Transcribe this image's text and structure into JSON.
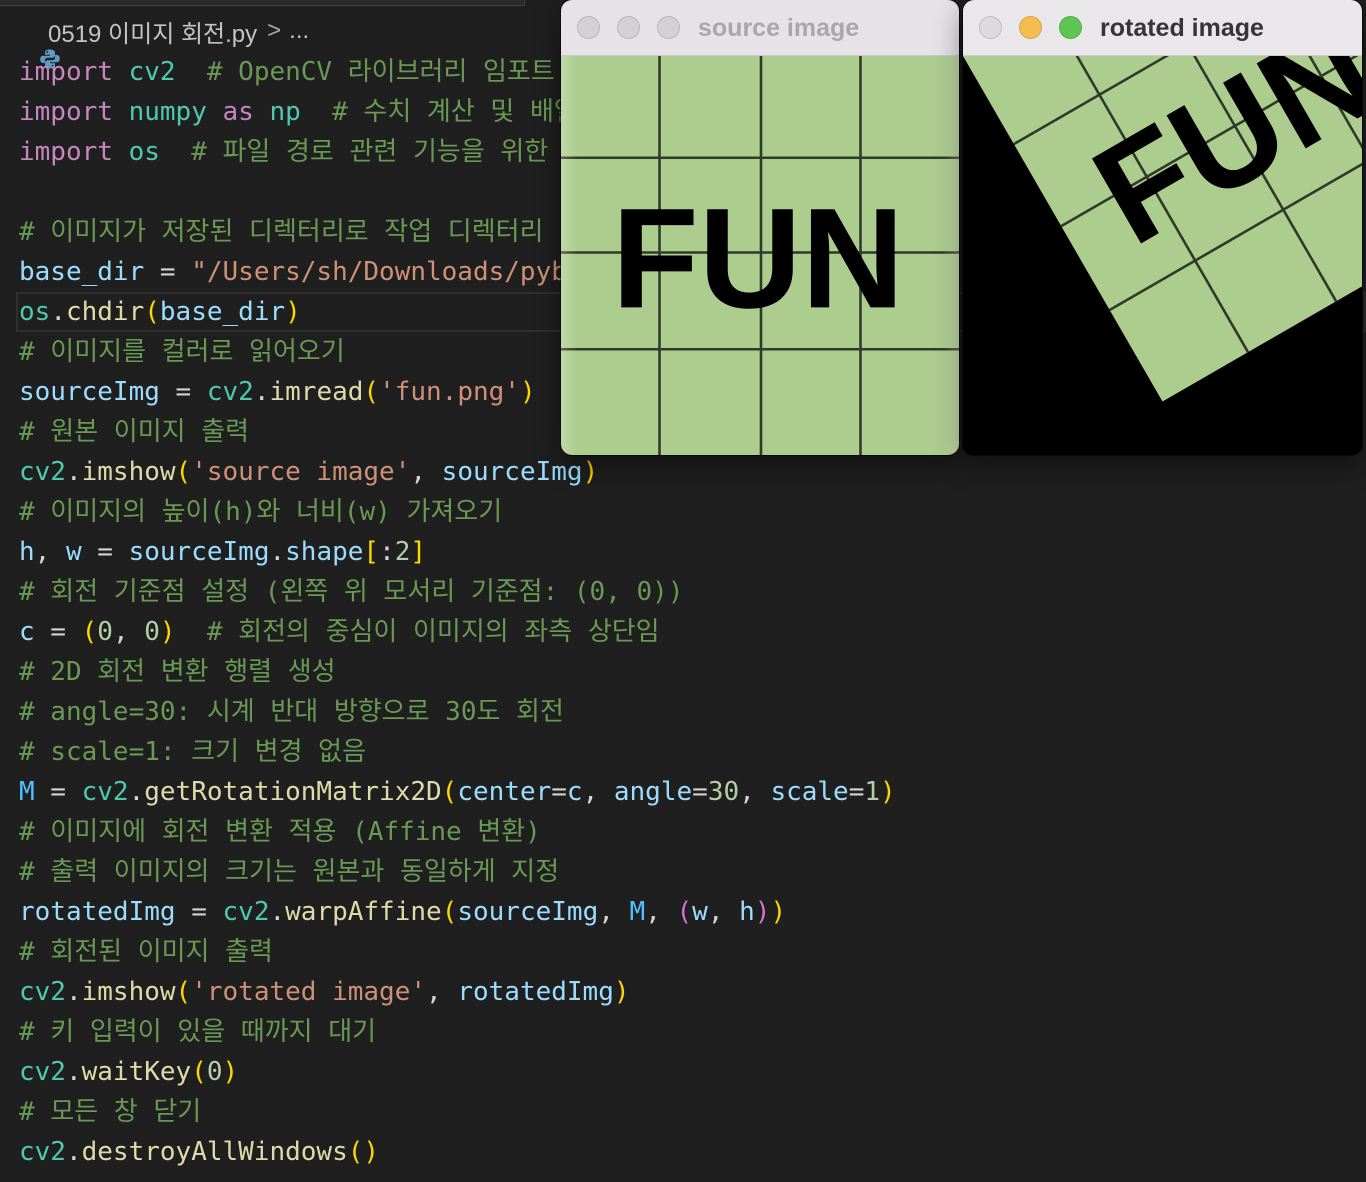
{
  "editor": {
    "breadcrumb": {
      "icon": "python-icon",
      "file": "0519 이미지 회전.py",
      "separator": ">",
      "more": "..."
    },
    "lines": [
      [
        [
          "import ",
          "#c586c0"
        ],
        [
          "cv2",
          "#4ec9b0"
        ],
        [
          "  # OpenCV 라이브러리 임포트",
          "#6a9955"
        ]
      ],
      [
        [
          "import ",
          "#c586c0"
        ],
        [
          "numpy ",
          "#4ec9b0"
        ],
        [
          "as ",
          "#c586c0"
        ],
        [
          "np",
          "#4ec9b0"
        ],
        [
          "  # 수치 계산 및 배열",
          "#6a9955"
        ]
      ],
      [
        [
          "import ",
          "#c586c0"
        ],
        [
          "os",
          "#4ec9b0"
        ],
        [
          "  # 파일 경로 관련 기능을 위한 o",
          "#6a9955"
        ]
      ],
      [],
      [
        [
          "# 이미지가 저장된 디렉터리로 작업 디렉터리 변",
          "#6a9955"
        ]
      ],
      [
        [
          "base_dir",
          "#9cdcfe"
        ],
        [
          " = ",
          "#d4d4d4"
        ],
        [
          "\"/Users/sh/Downloads/pyb",
          "#ce9178"
        ]
      ],
      [
        [
          "os",
          "#4ec9b0"
        ],
        [
          ".",
          "#d4d4d4"
        ],
        [
          "chdir",
          "#dcdcaa"
        ],
        [
          "(",
          "#ffd700"
        ],
        [
          "base_dir",
          "#9cdcfe"
        ],
        [
          ")",
          "#ffd700"
        ]
      ],
      [
        [
          "# 이미지를 컬러로 읽어오기",
          "#6a9955"
        ]
      ],
      [
        [
          "sourceImg",
          "#9cdcfe"
        ],
        [
          " = ",
          "#d4d4d4"
        ],
        [
          "cv2",
          "#4ec9b0"
        ],
        [
          ".",
          "#d4d4d4"
        ],
        [
          "imread",
          "#dcdcaa"
        ],
        [
          "(",
          "#ffd700"
        ],
        [
          "'fun.png'",
          "#ce9178"
        ],
        [
          ")",
          "#ffd700"
        ]
      ],
      [
        [
          "# 원본 이미지 출력",
          "#6a9955"
        ]
      ],
      [
        [
          "cv2",
          "#4ec9b0"
        ],
        [
          ".",
          "#d4d4d4"
        ],
        [
          "imshow",
          "#dcdcaa"
        ],
        [
          "(",
          "#ffd700"
        ],
        [
          "'source image'",
          "#ce9178"
        ],
        [
          ", ",
          "#d4d4d4"
        ],
        [
          "sourceImg",
          "#9cdcfe"
        ],
        [
          ")",
          "#ffd700"
        ]
      ],
      [
        [
          "# 이미지의 높이(h)와 너비(w) 가져오기",
          "#6a9955"
        ]
      ],
      [
        [
          "h",
          "#9cdcfe"
        ],
        [
          ", ",
          "#d4d4d4"
        ],
        [
          "w",
          "#9cdcfe"
        ],
        [
          " = ",
          "#d4d4d4"
        ],
        [
          "sourceImg",
          "#9cdcfe"
        ],
        [
          ".",
          "#d4d4d4"
        ],
        [
          "shape",
          "#9cdcfe"
        ],
        [
          "[",
          "#ffd700"
        ],
        [
          ":",
          "#d4d4d4"
        ],
        [
          "2",
          "#b5cea8"
        ],
        [
          "]",
          "#ffd700"
        ]
      ],
      [
        [
          "# 회전 기준점 설정 (왼쪽 위 모서리 기준점: (0, 0))",
          "#6a9955"
        ]
      ],
      [
        [
          "c",
          "#9cdcfe"
        ],
        [
          " = ",
          "#d4d4d4"
        ],
        [
          "(",
          "#ffd700"
        ],
        [
          "0",
          "#b5cea8"
        ],
        [
          ", ",
          "#d4d4d4"
        ],
        [
          "0",
          "#b5cea8"
        ],
        [
          ")",
          "#ffd700"
        ],
        [
          "  # 회전의 중심이 이미지의 좌측 상단임",
          "#6a9955"
        ]
      ],
      [
        [
          "# 2D 회전 변환 행렬 생성",
          "#6a9955"
        ]
      ],
      [
        [
          "# angle=30: 시계 반대 방향으로 30도 회전",
          "#6a9955"
        ]
      ],
      [
        [
          "# scale=1: 크기 변경 없음",
          "#6a9955"
        ]
      ],
      [
        [
          "M",
          "#4fc1ff"
        ],
        [
          " = ",
          "#d4d4d4"
        ],
        [
          "cv2",
          "#4ec9b0"
        ],
        [
          ".",
          "#d4d4d4"
        ],
        [
          "getRotationMatrix2D",
          "#dcdcaa"
        ],
        [
          "(",
          "#ffd700"
        ],
        [
          "center",
          "#9cdcfe"
        ],
        [
          "=",
          "#d4d4d4"
        ],
        [
          "c",
          "#9cdcfe"
        ],
        [
          ", ",
          "#d4d4d4"
        ],
        [
          "angle",
          "#9cdcfe"
        ],
        [
          "=",
          "#d4d4d4"
        ],
        [
          "30",
          "#b5cea8"
        ],
        [
          ", ",
          "#d4d4d4"
        ],
        [
          "scale",
          "#9cdcfe"
        ],
        [
          "=",
          "#d4d4d4"
        ],
        [
          "1",
          "#b5cea8"
        ],
        [
          ")",
          "#ffd700"
        ]
      ],
      [
        [
          "# 이미지에 회전 변환 적용 (Affine 변환)",
          "#6a9955"
        ]
      ],
      [
        [
          "# 출력 이미지의 크기는 원본과 동일하게 지정",
          "#6a9955"
        ]
      ],
      [
        [
          "rotatedImg",
          "#9cdcfe"
        ],
        [
          " = ",
          "#d4d4d4"
        ],
        [
          "cv2",
          "#4ec9b0"
        ],
        [
          ".",
          "#d4d4d4"
        ],
        [
          "warpAffine",
          "#dcdcaa"
        ],
        [
          "(",
          "#ffd700"
        ],
        [
          "sourceImg",
          "#9cdcfe"
        ],
        [
          ", ",
          "#d4d4d4"
        ],
        [
          "M",
          "#4fc1ff"
        ],
        [
          ", ",
          "#d4d4d4"
        ],
        [
          "(",
          "#da70d6"
        ],
        [
          "w",
          "#9cdcfe"
        ],
        [
          ", ",
          "#d4d4d4"
        ],
        [
          "h",
          "#9cdcfe"
        ],
        [
          ")",
          "#da70d6"
        ],
        [
          ")",
          "#ffd700"
        ]
      ],
      [
        [
          "# 회전된 이미지 출력",
          "#6a9955"
        ]
      ],
      [
        [
          "cv2",
          "#4ec9b0"
        ],
        [
          ".",
          "#d4d4d4"
        ],
        [
          "imshow",
          "#dcdcaa"
        ],
        [
          "(",
          "#ffd700"
        ],
        [
          "'rotated image'",
          "#ce9178"
        ],
        [
          ", ",
          "#d4d4d4"
        ],
        [
          "rotatedImg",
          "#9cdcfe"
        ],
        [
          ")",
          "#ffd700"
        ]
      ],
      [
        [
          "# 키 입력이 있을 때까지 대기",
          "#6a9955"
        ]
      ],
      [
        [
          "cv2",
          "#4ec9b0"
        ],
        [
          ".",
          "#d4d4d4"
        ],
        [
          "waitKey",
          "#dcdcaa"
        ],
        [
          "(",
          "#ffd700"
        ],
        [
          "0",
          "#b5cea8"
        ],
        [
          ")",
          "#ffd700"
        ]
      ],
      [
        [
          "# 모든 창 닫기",
          "#6a9955"
        ]
      ],
      [
        [
          "cv2",
          "#4ec9b0"
        ],
        [
          ".",
          "#d4d4d4"
        ],
        [
          "destroyAllWindows",
          "#dcdcaa"
        ],
        [
          "(",
          "#ffd700"
        ],
        [
          ")",
          "#ffd700"
        ]
      ]
    ]
  },
  "windows": {
    "source": {
      "title": "source image",
      "image_text": "FUN",
      "button_colors": [
        "#d3d1d3",
        "#d3d1d3",
        "#d3d1d3"
      ]
    },
    "rotated": {
      "title": "rotated image",
      "image_text": "FUN",
      "fill_color": "#000000",
      "button_colors": [
        "#dcdadc",
        "#f5bd4f",
        "#5fc454"
      ]
    }
  },
  "image": {
    "background": "#adcd8f",
    "grid_color": "#2f3a2a",
    "text_color": "#000000"
  }
}
